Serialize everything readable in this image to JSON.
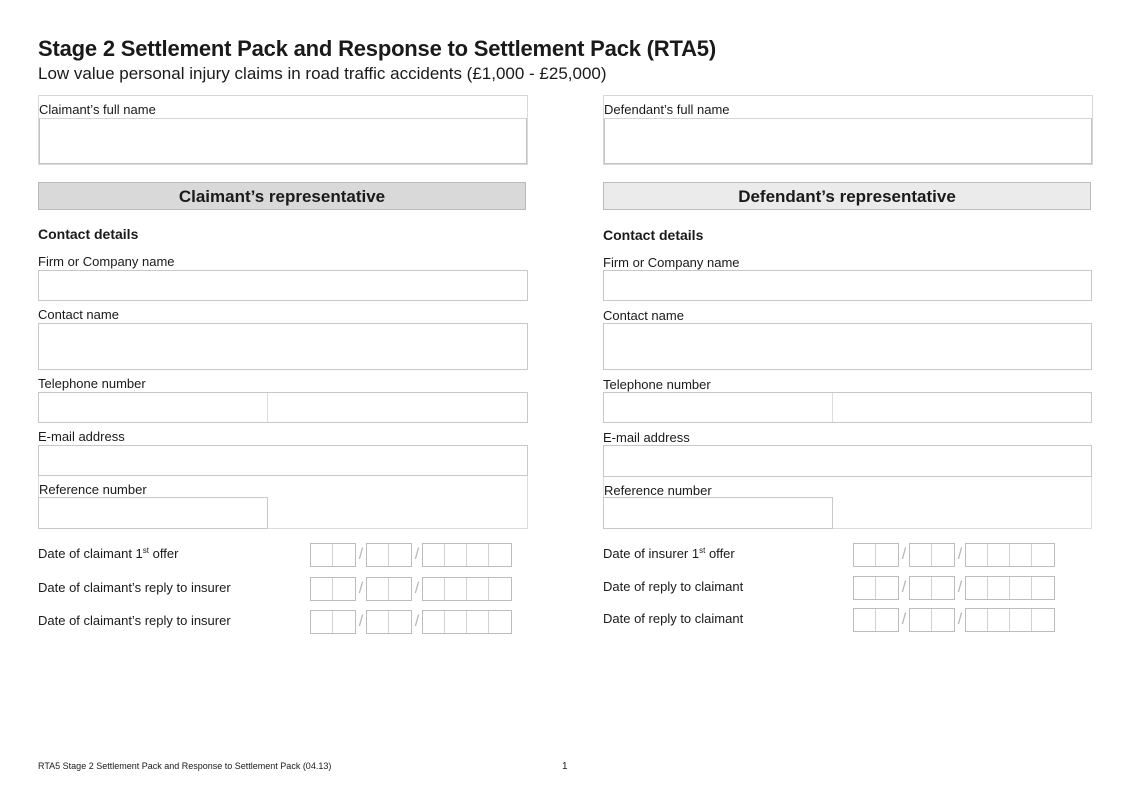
{
  "document": {
    "title": "Stage 2 Settlement Pack and Response to Settlement Pack (RTA5)",
    "subtitle": "Low value personal injury claims in road traffic accidents (£1,000 - £25,000)"
  },
  "claimant": {
    "full_name_label": "Claimant’s full name",
    "full_name_value": "",
    "rep_header": "Claimant’s representative",
    "contact_heading": "Contact details",
    "firm_label": "Firm or Company name",
    "firm_value": "",
    "contact_name_label": "Contact name",
    "contact_name_value": "",
    "telephone_label": "Telephone number",
    "telephone_value": "",
    "email_label": "E-mail address",
    "email_value": "",
    "reference_label": "Reference number",
    "reference_value": "",
    "dates": [
      {
        "label": "Date of claimant 1",
        "sup": "st",
        "suffix": " offer",
        "day": "",
        "month": "",
        "year": ""
      },
      {
        "label": "Date of claimant’s reply to insurer",
        "sup": "",
        "suffix": "",
        "day": "",
        "month": "",
        "year": ""
      },
      {
        "label": "Date of claimant’s reply to insurer",
        "sup": "",
        "suffix": "",
        "day": "",
        "month": "",
        "year": ""
      }
    ]
  },
  "defendant": {
    "full_name_label": "Defendant’s full name",
    "full_name_value": "",
    "rep_header": "Defendant’s representative",
    "contact_heading": "Contact details",
    "firm_label": "Firm or Company name",
    "firm_value": "",
    "contact_name_label": "Contact name",
    "contact_name_value": "",
    "telephone_label": "Telephone number",
    "telephone_value": "",
    "email_label": "E-mail address",
    "email_value": "",
    "reference_label": "Reference number",
    "reference_value": "",
    "dates": [
      {
        "label": "Date of insurer 1",
        "sup": "st",
        "suffix": " offer",
        "day": "",
        "month": "",
        "year": ""
      },
      {
        "label": "Date of reply to claimant",
        "sup": "",
        "suffix": "",
        "day": "",
        "month": "",
        "year": ""
      },
      {
        "label": "Date of reply to claimant",
        "sup": "",
        "suffix": "",
        "day": "",
        "month": "",
        "year": ""
      }
    ]
  },
  "date_separator": "/",
  "footer": {
    "text": "RTA5 Stage 2 Settlement Pack and Response to Settlement Pack (04.13)",
    "page_number": "1"
  },
  "colors": {
    "claimant_header_bg": "#d9d9d9",
    "defendant_header_bg": "#ebebeb",
    "field_border": "#c8c8c8"
  }
}
